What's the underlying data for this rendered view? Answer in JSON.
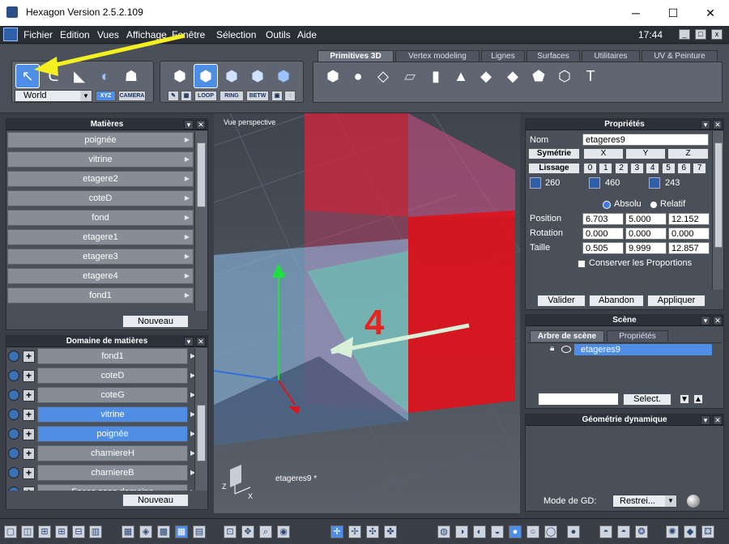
{
  "window": {
    "title": "Hexagon Version 2.5.2.109",
    "minimize": "─",
    "maximize": "☐",
    "close": "✕"
  },
  "menu": [
    "Fichier",
    "Edition",
    "Vues",
    "Affichage",
    "Fenêtre",
    "Sélection",
    "Outils",
    "Aide"
  ],
  "clock": "17:44",
  "toolbar": {
    "world_select": "World",
    "xyz": "XYZ",
    "camera": "CAMERA",
    "loop": "LOOP",
    "ring": "RING",
    "betw": "BETW"
  },
  "tabs": [
    "Primitives 3D",
    "Vertex modeling",
    "Lignes",
    "Surfaces",
    "Utilitaires",
    "UV & Peinture"
  ],
  "materials": {
    "title": "Matières",
    "items": [
      "poignée",
      "vitrine",
      "etagere2",
      "coteD",
      "fond",
      "etagere1",
      "etagere3",
      "etagere4",
      "fond1"
    ],
    "new_button": "Nouveau"
  },
  "domains": {
    "title": "Domaine de matières",
    "items": [
      {
        "label": "fond1",
        "highlight": false
      },
      {
        "label": "coteD",
        "highlight": false
      },
      {
        "label": "coteG",
        "highlight": false
      },
      {
        "label": "vitrine",
        "highlight": true
      },
      {
        "label": "poignée",
        "highlight": true
      },
      {
        "label": "charniereH",
        "highlight": false
      },
      {
        "label": "charniereB",
        "highlight": false
      },
      {
        "label": "Faces sans domaine",
        "highlight": false
      }
    ],
    "new_button": "Nouveau"
  },
  "viewport": {
    "label": "Vue perspective",
    "object_label": "etageres9 *",
    "annotation_number": "4",
    "annotation_color": "#e8241c",
    "axis_z": "Z",
    "axis_x": "X"
  },
  "properties": {
    "title": "Propriétés",
    "nom_label": "Nom",
    "nom_value": "etageres9",
    "symetrie": "Symétrie",
    "lissage": "Lissage",
    "axes": [
      "X",
      "Y",
      "Z"
    ],
    "levels": [
      "0",
      "1",
      "2",
      "3",
      "4",
      "5",
      "6",
      "7"
    ],
    "counts": [
      "260",
      "460",
      "243"
    ],
    "absolu": "Absolu",
    "relatif": "Relatif",
    "rows": [
      {
        "label": "Position",
        "values": [
          "6.703",
          "5.000",
          "12.152"
        ]
      },
      {
        "label": "Rotation",
        "values": [
          "0.000",
          "0.000",
          "0.000"
        ]
      },
      {
        "label": "Taille",
        "values": [
          "0.505",
          "9.999",
          "12.857"
        ]
      }
    ],
    "keep_proportions": "Conserver les Proportions",
    "valider": "Valider",
    "abandon": "Abandon",
    "appliquer": "Appliquer"
  },
  "scene": {
    "title": "Scène",
    "tabs": [
      "Arbre de scène",
      "Propriétés"
    ],
    "item": "etageres9",
    "select_button": "Select."
  },
  "dyn": {
    "title": "Géométrie dynamique",
    "mode_label": "Mode de GD:",
    "mode_value": "Restrei..."
  }
}
